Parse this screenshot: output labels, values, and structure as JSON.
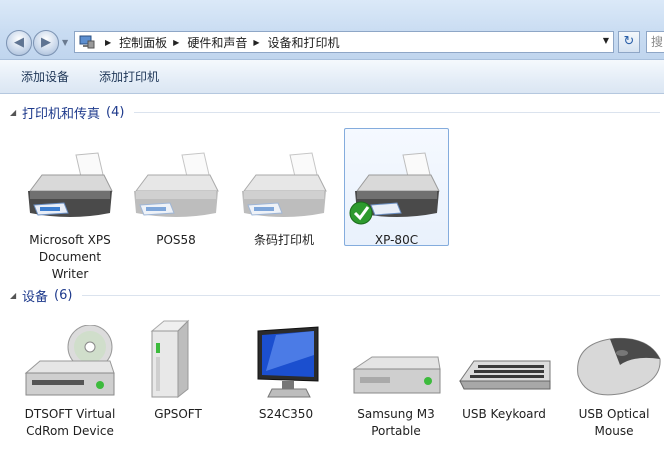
{
  "address": {
    "breadcrumbs": [
      "控制面板",
      "硬件和声音",
      "设备和打印机"
    ],
    "search_placeholder": "搜"
  },
  "toolbar": {
    "add_device": "添加设备",
    "add_printer": "添加打印机"
  },
  "groups": {
    "printers": {
      "title": "打印机和传真",
      "count": "(4)",
      "items": [
        {
          "line1": "Microsoft XPS",
          "line2": "Document",
          "line3": "Writer",
          "icon": "printer-icon"
        },
        {
          "line1": "POS58",
          "icon": "printer-icon"
        },
        {
          "line1": "条码打印机",
          "icon": "printer-icon"
        },
        {
          "line1": "XP-80C",
          "icon": "printer-default-icon",
          "default": true
        }
      ]
    },
    "devices": {
      "title": "设备",
      "count": "(6)",
      "items": [
        {
          "line1": "DTSOFT Virtual",
          "line2": "CdRom Device",
          "icon": "cdrom-drive-icon"
        },
        {
          "line1": "GPSOFT",
          "icon": "external-drive-icon"
        },
        {
          "line1": "S24C350",
          "icon": "monitor-icon"
        },
        {
          "line1": "Samsung M3",
          "line2": "Portable",
          "icon": "portable-drive-icon"
        },
        {
          "line1": "USB Keykoard",
          "icon": "keyboard-icon"
        },
        {
          "line1": "USB Optical",
          "line2": "Mouse",
          "icon": "mouse-icon"
        }
      ]
    }
  }
}
